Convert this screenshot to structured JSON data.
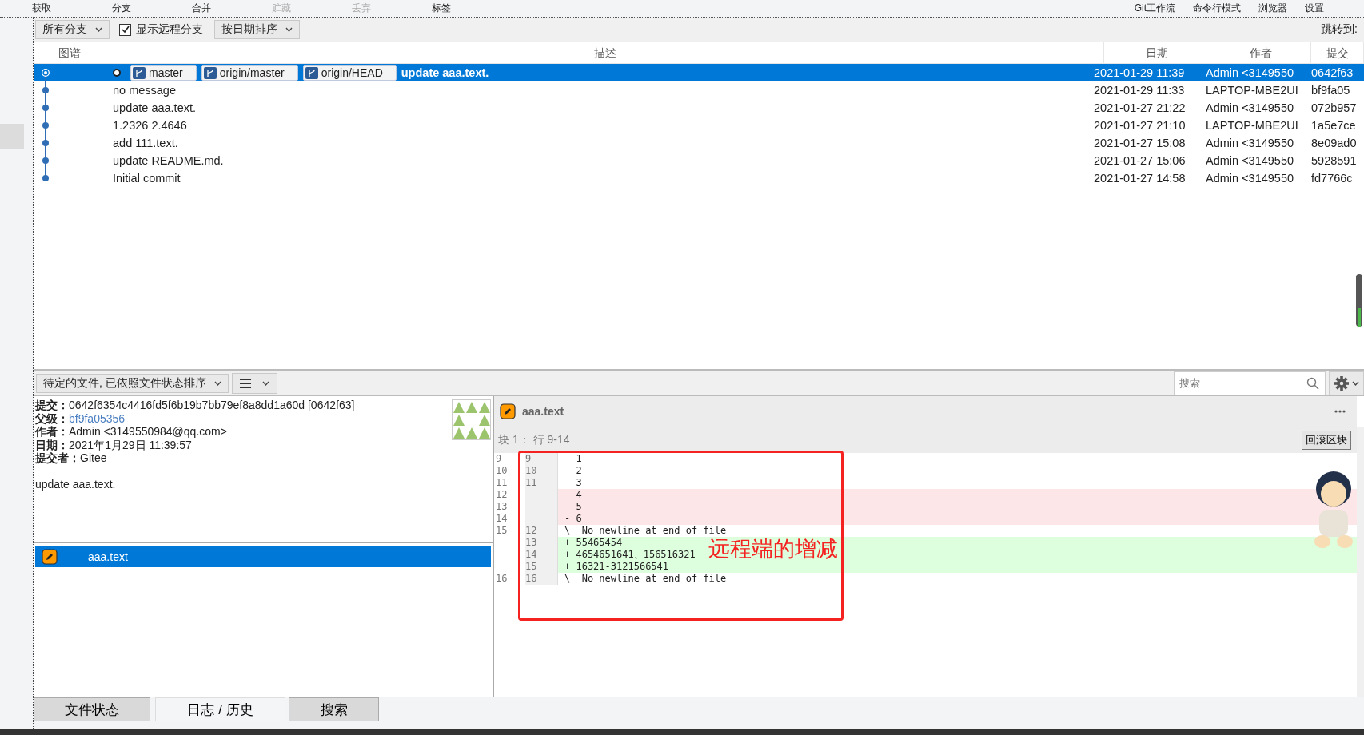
{
  "toolbar": {
    "left": [
      {
        "label": "获取",
        "disabled": false
      },
      {
        "label": "分支",
        "disabled": false
      },
      {
        "label": "合并",
        "disabled": false
      },
      {
        "label": "贮藏",
        "disabled": true
      },
      {
        "label": "丢弃",
        "disabled": true
      },
      {
        "label": "标签",
        "disabled": false
      }
    ],
    "right": [
      {
        "label": "Git工作流",
        "disabled": false
      },
      {
        "label": "命令行模式",
        "disabled": false
      },
      {
        "label": "浏览器",
        "disabled": false
      },
      {
        "label": "设置",
        "disabled": false
      }
    ]
  },
  "filter_bar": {
    "branch_dropdown": "所有分支",
    "remote_checkbox": {
      "label": "显示远程分支",
      "checked": true
    },
    "sort_dropdown": "按日期排序",
    "jump_label": "跳转到:"
  },
  "commit_table": {
    "columns": [
      "图谱",
      "描述",
      "日期",
      "作者",
      "提交"
    ],
    "rows": [
      {
        "selected": true,
        "head": true,
        "refs": [
          "master",
          "origin/master",
          "origin/HEAD"
        ],
        "description": "update aaa.text.",
        "date": "2021-01-29 11:39",
        "author": "Admin <3149550",
        "commit": "0642f63"
      },
      {
        "selected": false,
        "head": false,
        "refs": [],
        "description": "no message",
        "date": "2021-01-29 11:33",
        "author": "LAPTOP-MBE2UI",
        "commit": "bf9fa05"
      },
      {
        "selected": false,
        "head": false,
        "refs": [],
        "description": "update aaa.text.",
        "date": "2021-01-27 21:22",
        "author": "Admin <3149550",
        "commit": "072b957"
      },
      {
        "selected": false,
        "head": false,
        "refs": [],
        "description": "1.2326 2.4646",
        "date": "2021-01-27 21:10",
        "author": "LAPTOP-MBE2UI",
        "commit": "1a5e7ce"
      },
      {
        "selected": false,
        "head": false,
        "refs": [],
        "description": "add 111.text.",
        "date": "2021-01-27 15:08",
        "author": "Admin <3149550",
        "commit": "8e09ad0"
      },
      {
        "selected": false,
        "head": false,
        "refs": [],
        "description": "update README.md.",
        "date": "2021-01-27 15:06",
        "author": "Admin <3149550",
        "commit": "5928591"
      },
      {
        "selected": false,
        "head": false,
        "refs": [],
        "description": "Initial commit",
        "date": "2021-01-27 14:58",
        "author": "Admin <3149550",
        "commit": "fd7766c"
      }
    ]
  },
  "files_toolbar": {
    "sort_dropdown": "待定的文件, 已依照文件状态排序",
    "search": {
      "placeholder": "搜索"
    }
  },
  "commit_details": {
    "fields": [
      {
        "label": "提交：",
        "value": "0642f6354c4416fd5f6b19b7bb79ef8a8dd1a60d [0642f63]",
        "kind": "text"
      },
      {
        "label": "父级：",
        "value": "bf9fa05356",
        "kind": "link"
      },
      {
        "label": "作者：",
        "value": "Admin <3149550984@qq.com>",
        "kind": "text"
      },
      {
        "label": "日期：",
        "value": "2021年1月29日 11:39:57",
        "kind": "text"
      },
      {
        "label": "提交者：",
        "value": "Gitee",
        "kind": "text"
      }
    ],
    "message": "update aaa.text."
  },
  "files": [
    {
      "name": "aaa.text",
      "selected": true
    }
  ],
  "diff": {
    "file": "aaa.text",
    "hunk_title": "块 1： 行 9-14",
    "hunk_button": "回滚区块",
    "lines": [
      {
        "old": "9",
        "new": "9",
        "kind": "context",
        "text": "  1"
      },
      {
        "old": "10",
        "new": "10",
        "kind": "context",
        "text": "  2"
      },
      {
        "old": "11",
        "new": "11",
        "kind": "context",
        "text": "  3"
      },
      {
        "old": "12",
        "kind": "removed",
        "text": "- 4"
      },
      {
        "old": "13",
        "kind": "removed",
        "text": "- 5"
      },
      {
        "old": "14",
        "kind": "removed",
        "text": "- 6"
      },
      {
        "old": "15",
        "new": "12",
        "kind": "context",
        "text": "\\  No newline at end of file"
      },
      {
        "new": "13",
        "kind": "added",
        "text": "+ 55465454"
      },
      {
        "new": "14",
        "kind": "added",
        "text": "+ 4654651641、156516321"
      },
      {
        "new": "15",
        "kind": "added",
        "text": "+ 16321-3121566541"
      },
      {
        "old": "16",
        "new": "16",
        "kind": "context",
        "text": "\\  No newline at end of file"
      }
    ]
  },
  "annotation": {
    "text": "远程端的增减"
  },
  "bottom_tabs": [
    {
      "label": "文件状态",
      "selected": false
    },
    {
      "label": "日志 / 历史",
      "selected": true
    },
    {
      "label": "搜索",
      "selected": false
    }
  ]
}
